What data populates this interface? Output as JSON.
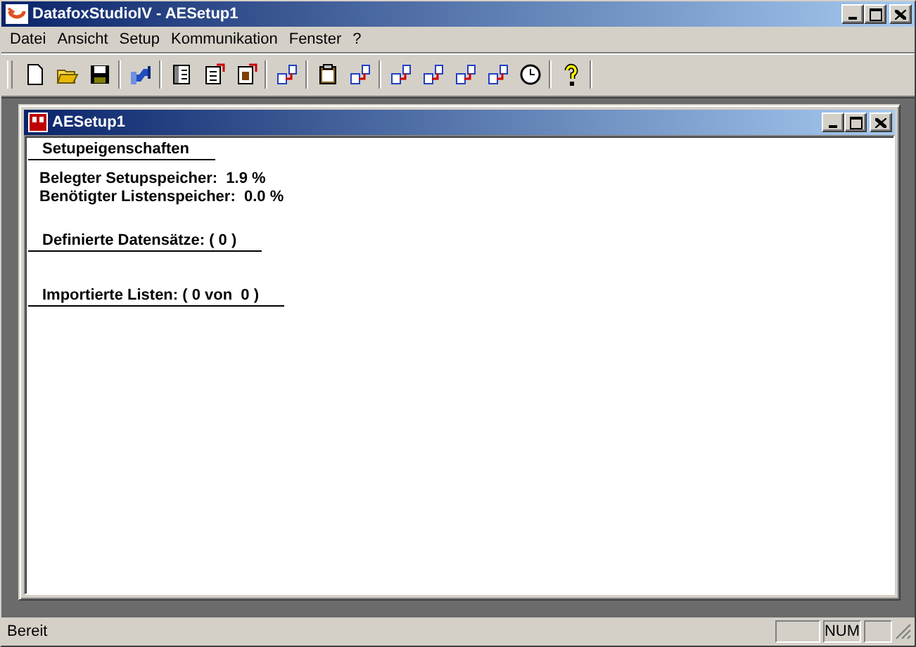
{
  "window": {
    "title": "DatafoxStudioIV - AESetup1"
  },
  "menu": [
    "Datei",
    "Ansicht",
    "Setup",
    "Kommunikation",
    "Fenster",
    "?"
  ],
  "document": {
    "title": "AESetup1",
    "sections": [
      {
        "heading": "Setupeigenschaften",
        "lines": [
          "Belegter Setupspeicher:  1.9 %",
          "Benötigter Listenspeicher:  0.0 %"
        ]
      },
      {
        "heading": "Definierte Datensätze: ( 0 )"
      },
      {
        "heading": "Importierte Listen: ( 0 von  0 )"
      }
    ]
  },
  "status_bar": {
    "text": "Bereit",
    "indicator": "NUM"
  }
}
